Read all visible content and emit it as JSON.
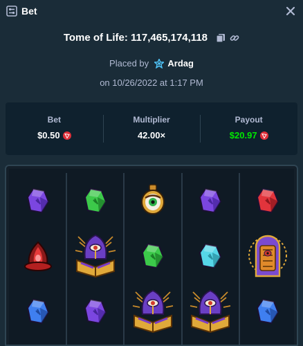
{
  "header": {
    "title": "Bet",
    "icon": "bet-slip-icon",
    "close_icon": "close-icon"
  },
  "game": {
    "name_id": "Tome of Life: 117,465,174,118",
    "copy_icon": "copy-icon",
    "link_icon": "link-icon"
  },
  "placed": {
    "prefix": "Placed by",
    "user": "Ardag",
    "vip_icon": "vip-badge-icon"
  },
  "date": "on 10/26/2022 at 1:17 PM",
  "stats": {
    "bet_label": "Bet",
    "bet_value": "$0.50",
    "multiplier_label": "Multiplier",
    "multiplier_value": "42.00×",
    "payout_label": "Payout",
    "payout_value": "$20.97",
    "currency_icon": "tron-coin-icon"
  },
  "colors": {
    "background": "#1a2c38",
    "panel": "#0f212e",
    "payout": "#00e701",
    "muted": "#b1bad3"
  },
  "reels": [
    [
      "purple-gem",
      "red-cauldron-pot",
      "blue-gem"
    ],
    [
      "green-gem",
      "tome-book",
      "purple-gem"
    ],
    [
      "eye-amulet",
      "green-gem",
      "tome-book"
    ],
    [
      "purple-gem",
      "cyan-gem",
      "tome-book"
    ],
    [
      "red-gem",
      "ornate-door",
      "blue-gem"
    ]
  ]
}
